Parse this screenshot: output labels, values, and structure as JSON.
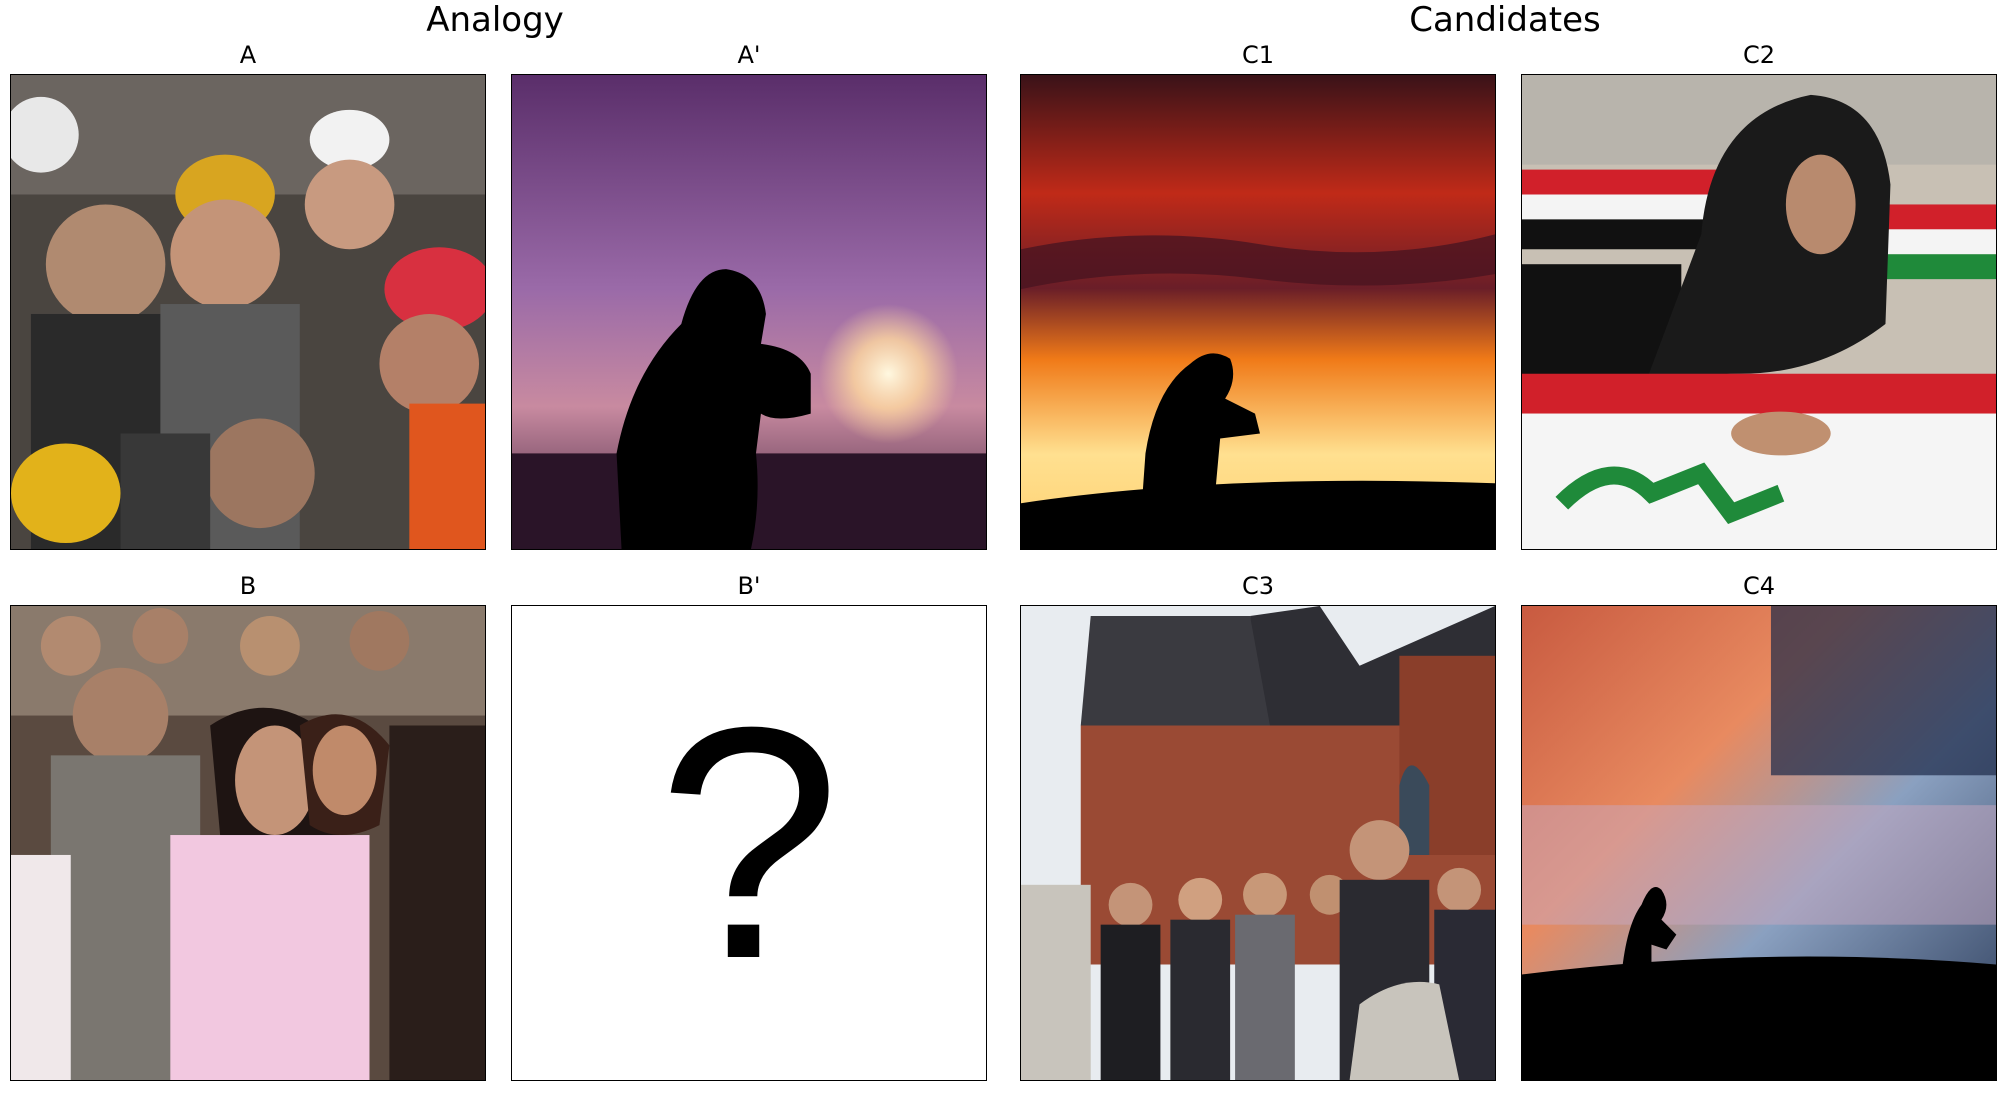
{
  "titles": {
    "analogy": "Analogy",
    "candidates": "Candidates"
  },
  "panels": {
    "A": {
      "label": "A"
    },
    "A_prime": {
      "label": "A'"
    },
    "B": {
      "label": "B"
    },
    "B_prime": {
      "label": "B'",
      "placeholder": "?"
    },
    "C1": {
      "label": "C1"
    },
    "C2": {
      "label": "C2"
    },
    "C3": {
      "label": "C3"
    },
    "C4": {
      "label": "C4"
    }
  },
  "colors": {
    "border": "#000000",
    "purple_sky": "#7a4a8a",
    "sunset_orange": "#e8621c",
    "flag_red": "#d1202a",
    "flag_green": "#1f8a3a"
  }
}
